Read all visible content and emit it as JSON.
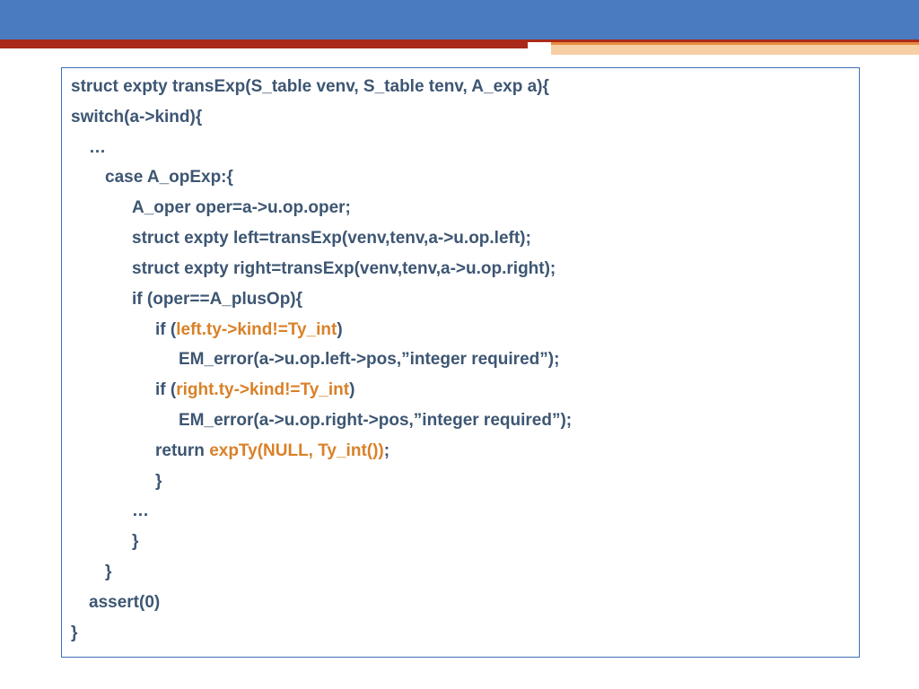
{
  "colors": {
    "header_blue": "#4a7ac0",
    "header_red": "#a92a1a",
    "accent_fill": "#f7cfa4",
    "accent_edge": "#e78a3f",
    "code_text": "#3d5673",
    "highlight": "#d98128",
    "box_border": "#3b6fb6"
  },
  "code": {
    "l0": "struct expty transExp(S_table venv, S_table tenv, A_exp a){",
    "l1": "switch(a->kind){",
    "l2": "…",
    "l3": "case A_opExp:{",
    "l4": "A_oper oper=a->u.op.oper;",
    "l5": "struct expty left=transExp(venv,tenv,a->u.op.left);",
    "l6": "struct expty right=transExp(venv,tenv,a->u.op.right);",
    "l7": "if (oper==A_plusOp){",
    "l8a": "if (",
    "l8b": "left.ty->kind!=Ty_int",
    "l8c": ")",
    "l9": "EM_error(a->u.op.left->pos,”integer required”);",
    "l10a": "if (",
    "l10b": "right.ty->kind!=Ty_int",
    "l10c": ")",
    "l11": "EM_error(a->u.op.right->pos,”integer required”);",
    "l12a": "return ",
    "l12b": "expTy(NULL, Ty_int())",
    "l12c": ";",
    "l13": "}",
    "l14": "…",
    "l15": "}",
    "l16": "}",
    "l17": "assert(0)",
    "l18": "}"
  }
}
